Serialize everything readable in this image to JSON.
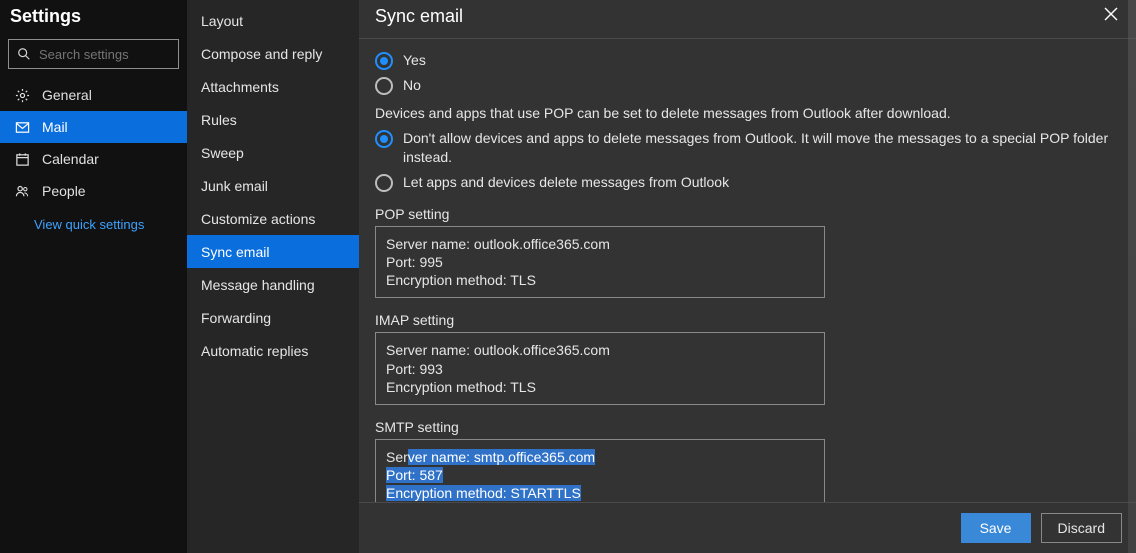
{
  "sidebarLeft": {
    "title": "Settings",
    "searchPlaceholder": "Search settings",
    "items": [
      {
        "label": "General"
      },
      {
        "label": "Mail"
      },
      {
        "label": "Calendar"
      },
      {
        "label": "People"
      }
    ],
    "quickSettings": "View quick settings"
  },
  "sidebarMid": {
    "items": [
      {
        "label": "Layout"
      },
      {
        "label": "Compose and reply"
      },
      {
        "label": "Attachments"
      },
      {
        "label": "Rules"
      },
      {
        "label": "Sweep"
      },
      {
        "label": "Junk email"
      },
      {
        "label": "Customize actions"
      },
      {
        "label": "Sync email"
      },
      {
        "label": "Message handling"
      },
      {
        "label": "Forwarding"
      },
      {
        "label": "Automatic replies"
      }
    ]
  },
  "main": {
    "title": "Sync email",
    "yesLabel": "Yes",
    "noLabel": "No",
    "popDescription": "Devices and apps that use POP can be set to delete messages from Outlook after download.",
    "popOption1": "Don't allow devices and apps to delete messages from Outlook. It will move the messages to a special POP folder instead.",
    "popOption2": "Let apps and devices delete messages from Outlook",
    "sections": {
      "pop": {
        "title": "POP setting",
        "server": "Server name: outlook.office365.com",
        "port": "Port: 995",
        "enc": "Encryption method: TLS"
      },
      "imap": {
        "title": "IMAP setting",
        "server": "Server name: outlook.office365.com",
        "port": "Port: 993",
        "enc": "Encryption method: TLS"
      },
      "smtp": {
        "title": "SMTP setting",
        "serverPrefix": "Ser",
        "serverRest": "ver name: smtp.office365.com",
        "port": "Port: 587",
        "enc": "Encryption method: STARTTLS"
      }
    },
    "saveLabel": "Save",
    "discardLabel": "Discard"
  }
}
